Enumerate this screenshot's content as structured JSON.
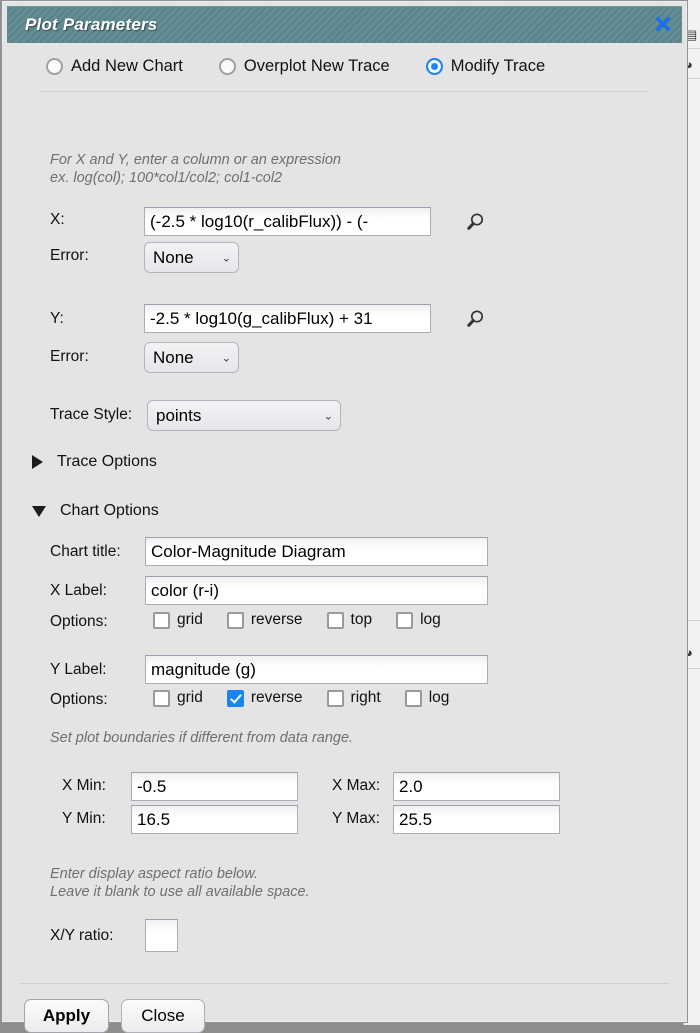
{
  "window": {
    "title": "Plot Parameters",
    "close_icon": "close-x-icon",
    "titlebar_color": "#5e8a90",
    "accent_color": "#1a84f5"
  },
  "mode": {
    "options": [
      {
        "label": "Add New Chart",
        "selected": false
      },
      {
        "label": "Overplot New Trace",
        "selected": false
      },
      {
        "label": "Modify Trace",
        "selected": true
      }
    ]
  },
  "expression_hint": {
    "line1": "For X and Y, enter a column or an expression",
    "line2": "ex. log(col); 100*col1/col2; col1-col2"
  },
  "x_axis": {
    "label": "X:",
    "value": "(-2.5 * log10(r_calibFlux)) - (-",
    "placeholder": "",
    "search_icon": "magnifier-icon",
    "error_label": "Error:",
    "error_value": "None",
    "error_options": [
      "None"
    ]
  },
  "y_axis": {
    "label": "Y:",
    "value": "-2.5 * log10(g_calibFlux) + 31",
    "placeholder": "",
    "search_icon": "magnifier-icon",
    "error_label": "Error:",
    "error_value": "None",
    "error_options": [
      "None"
    ]
  },
  "trace_style": {
    "label": "Trace Style:",
    "value": "points",
    "options": [
      "points"
    ]
  },
  "sections": {
    "trace_options": {
      "label": "Trace Options",
      "expanded": false
    },
    "chart_options": {
      "label": "Chart Options",
      "expanded": true
    }
  },
  "chart_options": {
    "chart_title": {
      "label": "Chart title:",
      "value": "Color-Magnitude Diagram"
    },
    "x_label": {
      "label": "X Label:",
      "value": "color (r-i)"
    },
    "x_options": {
      "label": "Options:",
      "items": [
        {
          "label": "grid",
          "checked": false
        },
        {
          "label": "reverse",
          "checked": false
        },
        {
          "label": "top",
          "checked": false
        },
        {
          "label": "log",
          "checked": false
        }
      ]
    },
    "y_label": {
      "label": "Y Label:",
      "value": "magnitude (g)"
    },
    "y_options": {
      "label": "Options:",
      "items": [
        {
          "label": "grid",
          "checked": false
        },
        {
          "label": "reverse",
          "checked": true
        },
        {
          "label": "right",
          "checked": false
        },
        {
          "label": "log",
          "checked": false
        }
      ]
    },
    "boundaries_hint": "Set plot boundaries if different from data range.",
    "bounds": {
      "x_min": {
        "label": "X Min:",
        "value": "-0.5"
      },
      "x_max": {
        "label": "X Max:",
        "value": "2.0"
      },
      "y_min": {
        "label": "Y Min:",
        "value": "16.5"
      },
      "y_max": {
        "label": "Y Max:",
        "value": "25.5"
      }
    },
    "aspect_hint": {
      "line1": "Enter display aspect ratio below.",
      "line2": "Leave it blank to use all available space."
    },
    "xy_ratio": {
      "label": "X/Y ratio:",
      "value": ""
    }
  },
  "footer": {
    "apply_label": "Apply",
    "close_label": "Close"
  }
}
